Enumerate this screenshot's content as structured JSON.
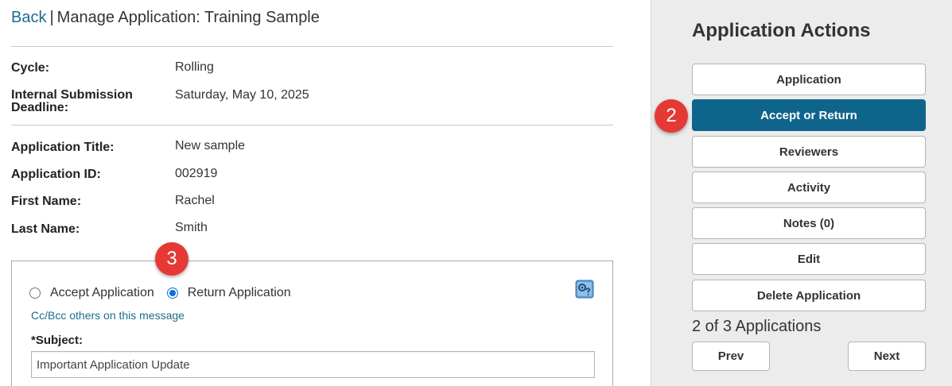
{
  "header": {
    "back_label": "Back",
    "separator": "|",
    "title": "Manage Application: Training Sample"
  },
  "details": {
    "cycle_label": "Cycle:",
    "cycle_value": "Rolling",
    "deadline_label_line1": "Internal Submission",
    "deadline_label_line2": "Deadline:",
    "deadline_value": "Saturday, May 10, 2025",
    "app_title_label": "Application Title:",
    "app_title_value": "New sample",
    "app_id_label": "Application ID:",
    "app_id_value": "002919",
    "first_name_label": "First Name:",
    "first_name_value": "Rachel",
    "last_name_label": "Last Name:",
    "last_name_value": "Smith"
  },
  "decision_panel": {
    "accept_label": "Accept Application",
    "return_label": "Return Application",
    "selected": "return",
    "cc_link": "Cc/Bcc others on this message",
    "subject_label": "*Subject:",
    "subject_value": "Important Application Update",
    "help_icon": "help-settings-icon"
  },
  "badges": {
    "step2": "2",
    "step3": "3",
    "color": "#e53935"
  },
  "sidebar": {
    "title": "Application Actions",
    "actions": [
      {
        "label": "Application",
        "active": false
      },
      {
        "label": "Accept or Return",
        "active": true
      },
      {
        "label": "Reviewers",
        "active": false
      },
      {
        "label": "Activity",
        "active": false
      },
      {
        "label": "Notes (0)",
        "active": false
      },
      {
        "label": "Edit",
        "active": false
      },
      {
        "label": "Delete Application",
        "active": false
      }
    ],
    "counter": "2 of 3 Applications",
    "prev_label": "Prev",
    "next_label": "Next",
    "accent_color": "#0f648c"
  }
}
